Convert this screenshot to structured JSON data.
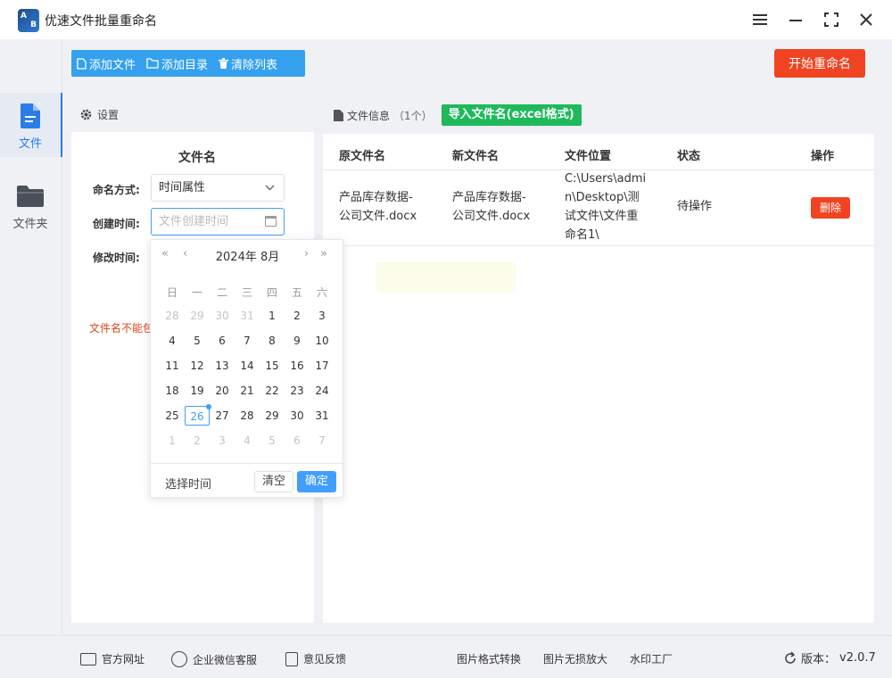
{
  "app": {
    "title": "优速文件批量重命名",
    "logo_letters": [
      "A",
      "B"
    ]
  },
  "nav": [
    {
      "label": "文件",
      "icon": "file-icon",
      "active": true
    },
    {
      "label": "文件夹",
      "icon": "folder-icon",
      "active": false
    }
  ],
  "toolbar": {
    "add_file": "添加文件",
    "add_dir": "添加目录",
    "clear_list": "清除列表"
  },
  "start_button": "开始重命名",
  "settings": {
    "header": "设置",
    "section_title": "文件名",
    "naming_label": "命名方式:",
    "naming_value": "时间属性",
    "created_label": "创建时间:",
    "created_placeholder": "文件创建时间",
    "modified_label": "修改时间:",
    "warning_text": "文件名不能包"
  },
  "datepicker": {
    "year_month": "2024年 8月",
    "weekdays": [
      "日",
      "一",
      "二",
      "三",
      "四",
      "五",
      "六"
    ],
    "days": [
      [
        "28",
        "29",
        "30",
        "31",
        "1",
        "2",
        "3"
      ],
      [
        "4",
        "5",
        "6",
        "7",
        "8",
        "9",
        "10"
      ],
      [
        "11",
        "12",
        "13",
        "14",
        "15",
        "16",
        "17"
      ],
      [
        "18",
        "19",
        "20",
        "21",
        "22",
        "23",
        "24"
      ],
      [
        "25",
        "26",
        "27",
        "28",
        "29",
        "30",
        "31"
      ],
      [
        "1",
        "2",
        "3",
        "4",
        "5",
        "6",
        "7"
      ]
    ],
    "selected": "26",
    "footer_label": "选择时间",
    "clear_label": "清空",
    "ok_label": "确定"
  },
  "fileinfo": {
    "header": "文件信息",
    "count": "（1个）",
    "import_button": "导入文件名(excel格式)",
    "columns": [
      "原文件名",
      "新文件名",
      "文件位置",
      "状态",
      "操作"
    ],
    "rows": [
      {
        "original": [
          "产品库存数据-",
          "公司文件.docx"
        ],
        "new": [
          "产品库存数据-",
          "公司文件.docx"
        ],
        "location": [
          "C:\\Users\\admi",
          "n\\Desktop\\测",
          "试文件\\文件重",
          "命名1\\"
        ],
        "status": "待操作",
        "action": "删除"
      }
    ]
  },
  "footer": {
    "website": "官方网址",
    "wechat": "企业微信客服",
    "feedback": "意见反馈",
    "format_convert": "图片格式转换",
    "lossless_enlarge": "图片无损放大",
    "watermark": "水印工厂",
    "version_label": "版本：",
    "version": "v2.0.7"
  },
  "colors": {
    "accent": "#35a1ee",
    "danger": "#ef4322",
    "green": "#1fb95c",
    "picker_blue": "#409eff"
  }
}
